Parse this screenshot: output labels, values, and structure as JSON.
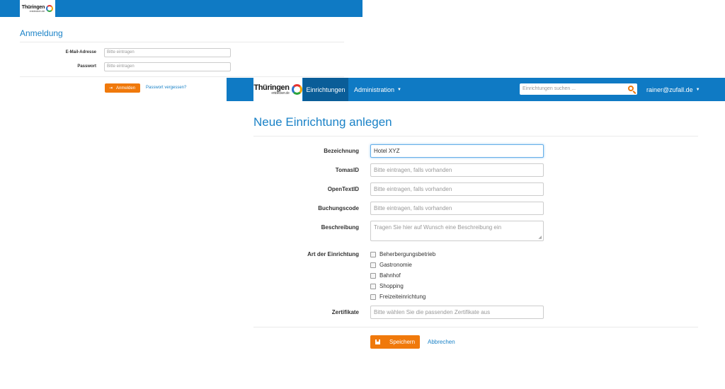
{
  "login": {
    "logo_text": "Thüringen",
    "logo_sub": "entdecken.de",
    "title": "Anmeldung",
    "email_label": "E-Mail-Adresse",
    "email_placeholder": "Bitte eintragen",
    "password_label": "Passwort",
    "password_placeholder": "Bitte eintragen",
    "submit_label": "Anmelden",
    "forgot_link": "Passwort vergessen?"
  },
  "navbar": {
    "logo_text": "Thüringen",
    "logo_sub": "entdecken.de",
    "active_item": "Einrichtungen",
    "admin_item": "Administration",
    "search_placeholder": "Einrichtungen suchen ...",
    "user": "rainer@zufall.de",
    "caret": "▼"
  },
  "form": {
    "title": "Neue Einrichtung anlegen",
    "bezeichnung_label": "Bezeichnung",
    "bezeichnung_value": "Hotel XYZ",
    "tomasid_label": "TomasID",
    "tomasid_placeholder": "Bitte eintragen, falls vorhanden",
    "opentextid_label": "OpenTextID",
    "opentextid_placeholder": "Bitte eintragen, falls vorhanden",
    "buchungscode_label": "Buchungscode",
    "buchungscode_placeholder": "Bitte eintragen, falls vorhanden",
    "beschreibung_label": "Beschreibung",
    "beschreibung_placeholder": "Tragen Sie hier auf Wunsch eine Beschreibung ein",
    "art_label": "Art der Einrichtung",
    "art_options": [
      {
        "label": "Beherbergungsbetrieb",
        "checked": false
      },
      {
        "label": "Gastronomie",
        "checked": false
      },
      {
        "label": "Bahnhof",
        "checked": false
      },
      {
        "label": "Shopping",
        "checked": false
      },
      {
        "label": "Freizeiteinrichtung",
        "checked": false
      }
    ],
    "zertifikate_label": "Zertifikate",
    "zertifikate_placeholder": "Bitte wählen Sie die passenden Zertifikate aus",
    "save_label": "Speichern",
    "cancel_label": "Abbrechen"
  },
  "colors": {
    "brand_blue": "#0f7ac4",
    "nav_active": "#0a5d98",
    "accent_orange": "#f0790b",
    "title_blue": "#1a82c7"
  }
}
